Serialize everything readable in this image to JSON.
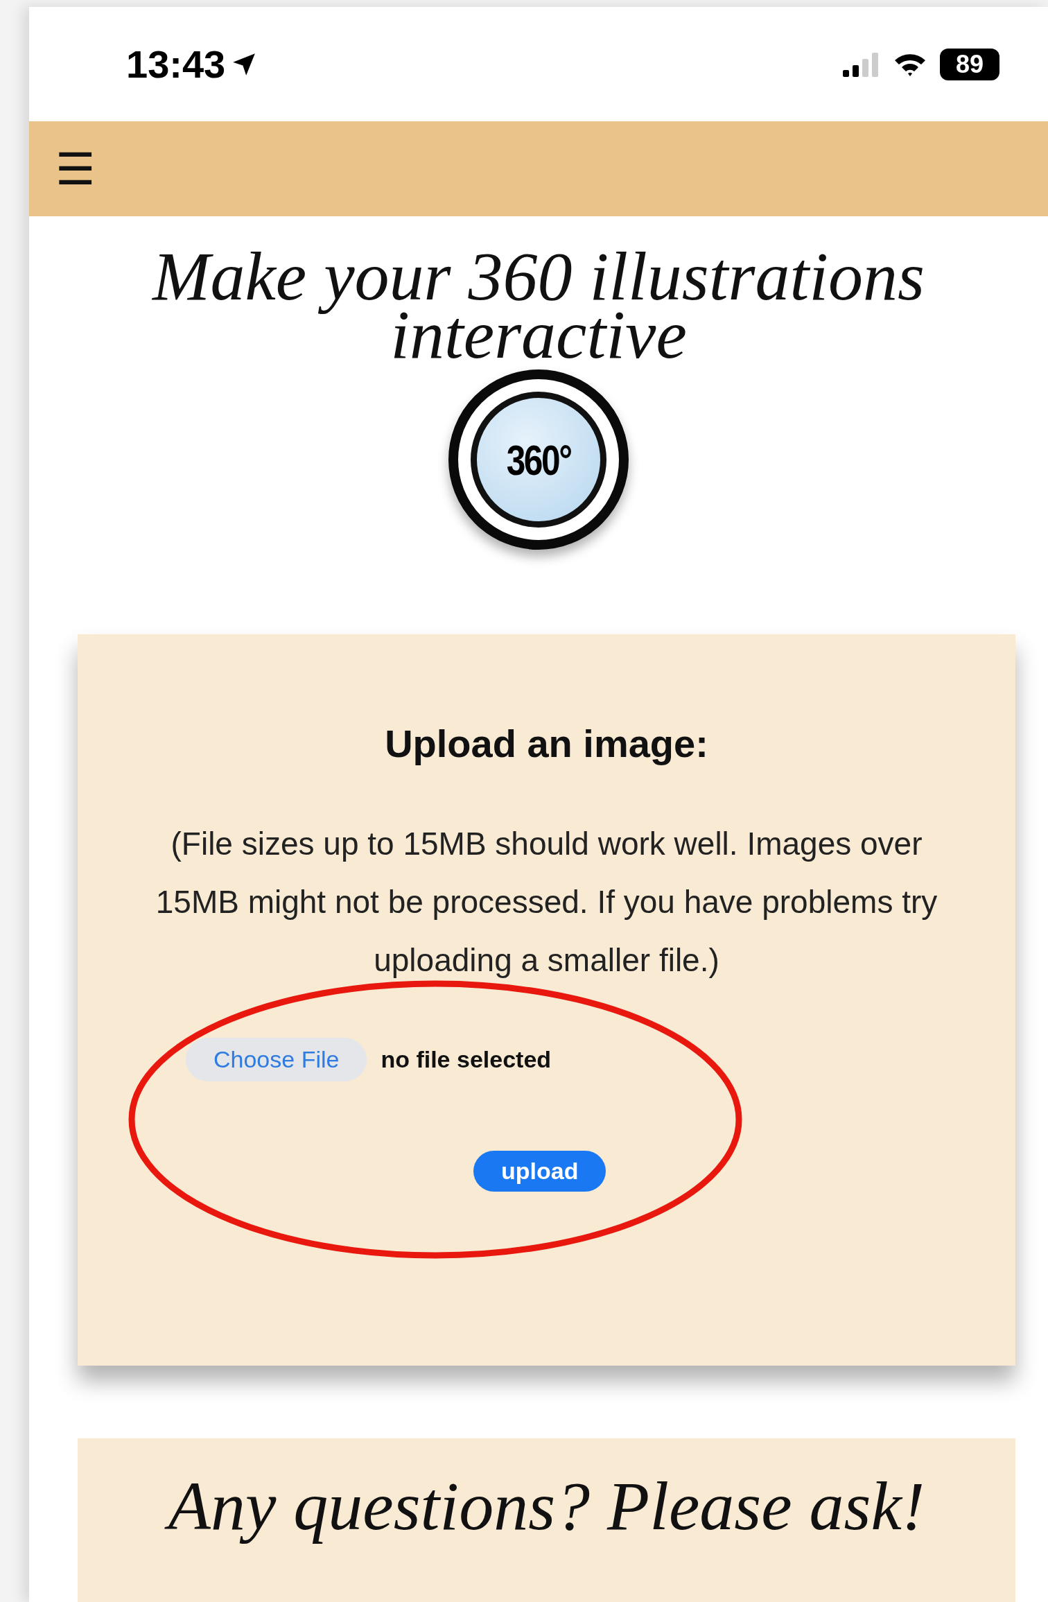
{
  "status_bar": {
    "time": "13:43",
    "battery": "89"
  },
  "header": {
    "menu_icon": "☰"
  },
  "hero": {
    "title": "Make your 360 illustrations interactive",
    "badge": "360°"
  },
  "upload_card": {
    "heading": "Upload an image:",
    "note": "(File sizes up to 15MB should work well. Images over 15MB might not be processed. If you have problems try uploading a smaller file.)",
    "file_button": "Choose File",
    "file_status": "no file selected",
    "submit": "upload"
  },
  "questions_card": {
    "heading": "Any questions? Please ask!"
  }
}
